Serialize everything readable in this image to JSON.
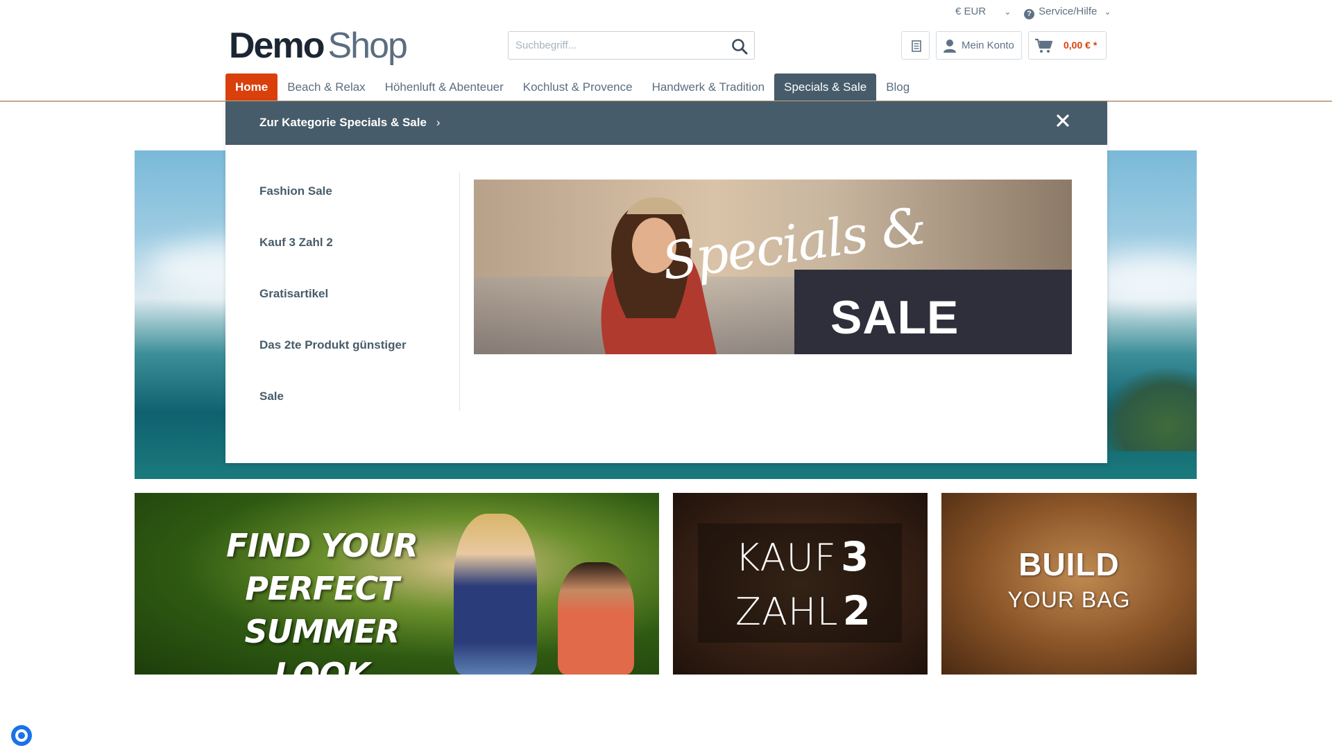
{
  "topbar": {
    "currency": "€ EUR",
    "service": "Service/Hilfe"
  },
  "header": {
    "logo_part1": "Demo",
    "logo_part2": "Shop",
    "search_placeholder": "Suchbegriff...",
    "account_label": "Mein Konto",
    "cart_total": "0,00 € *"
  },
  "nav": {
    "items": [
      {
        "label": "Home"
      },
      {
        "label": "Beach & Relax"
      },
      {
        "label": "Höhenluft & Abenteuer"
      },
      {
        "label": "Kochlust & Provence"
      },
      {
        "label": "Handwerk & Tradition"
      },
      {
        "label": "Specials & Sale"
      },
      {
        "label": "Blog"
      }
    ],
    "active": "Specials & Sale"
  },
  "mega_menu": {
    "category_link": "Zur Kategorie Specials & Sale",
    "items": [
      {
        "label": "Fashion Sale"
      },
      {
        "label": "Kauf 3 Zahl 2"
      },
      {
        "label": "Gratisartikel"
      },
      {
        "label": "Das 2te Produkt günstiger"
      },
      {
        "label": "Sale"
      }
    ],
    "banner_script": "Specials &",
    "banner_big": "SALE"
  },
  "teasers": {
    "t1_lines": [
      "FIND YOUR",
      "PERFECT",
      "SUMMER LOOK"
    ],
    "t2_line1_word": "KAUF",
    "t2_line1_num": "3",
    "t2_line2_word": "ZAHL",
    "t2_line2_num": "2",
    "t3_big": "BUILD",
    "t3_small": "YOUR BAG"
  },
  "colors": {
    "accent": "#d9400b",
    "nav_active": "#475c6a",
    "text": "#5b6d80"
  },
  "icons": {
    "search": "search-icon",
    "close": "close-icon",
    "cart": "cart-icon",
    "user": "user-icon",
    "notes": "notes-icon"
  }
}
